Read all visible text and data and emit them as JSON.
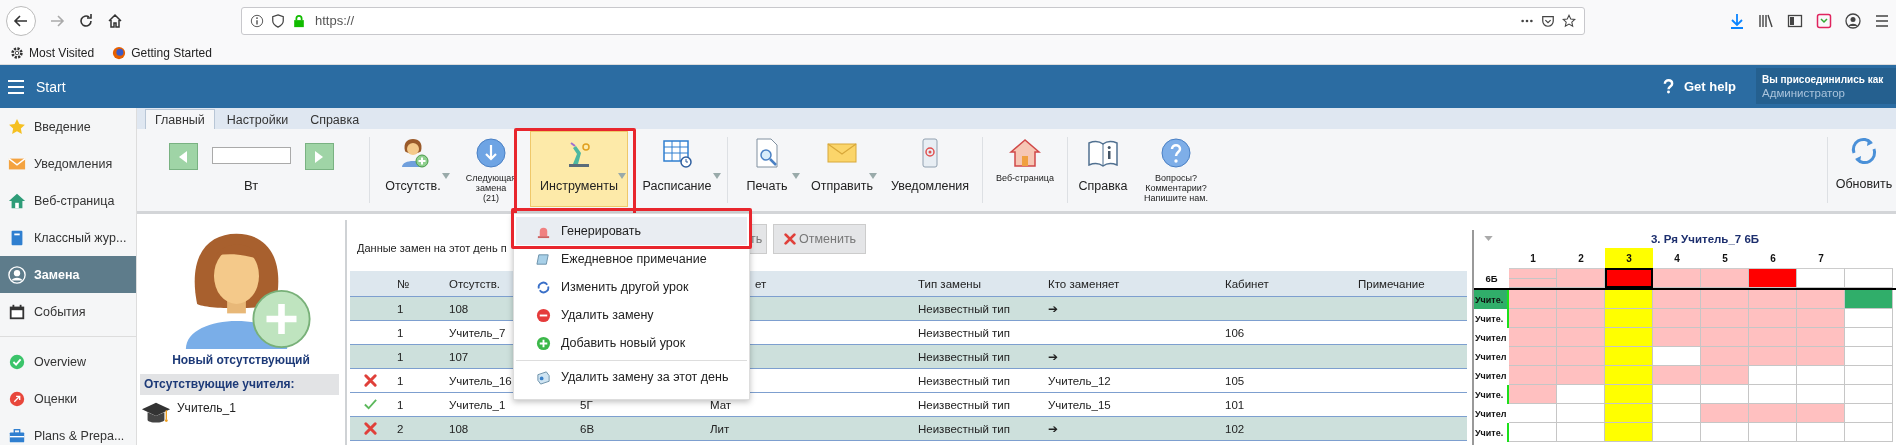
{
  "browser": {
    "url": "https://",
    "bookmarks": [
      {
        "label": "Most Visited"
      },
      {
        "label": "Getting Started"
      }
    ]
  },
  "header": {
    "title": "Start",
    "help": "Get help",
    "account": {
      "caption": "Вы присоединились как",
      "role": "Администратор"
    }
  },
  "sidebar": {
    "sections": [
      {
        "items": [
          {
            "label": "Введение",
            "selected": false
          },
          {
            "label": "Уведомления",
            "selected": false
          },
          {
            "label": "Веб-страница",
            "selected": false
          },
          {
            "label": "Классный жур...",
            "selected": false
          },
          {
            "label": "Замена",
            "selected": true
          },
          {
            "label": "События",
            "selected": false
          }
        ]
      },
      {
        "items": [
          {
            "label": "Overview",
            "selected": false
          },
          {
            "label": "Оценки",
            "selected": false
          },
          {
            "label": "Plans & Prepa...",
            "selected": false
          }
        ]
      }
    ]
  },
  "ribbon": {
    "tabs": [
      {
        "label": "Главный",
        "selected": true
      },
      {
        "label": "Настройки",
        "selected": false
      },
      {
        "label": "Справка",
        "selected": false
      }
    ],
    "date_nav": {
      "day": "Вт"
    },
    "groups": [
      {
        "buttons": [
          {
            "lines": [
              "Отсутств."
            ],
            "kind": "large",
            "dropdown": true,
            "highlighted": false,
            "framed": false
          },
          {
            "lines": [
              "Следующая",
              "замена",
              "(21)"
            ],
            "kind": "small",
            "dropdown": false,
            "highlighted": false,
            "framed": false
          },
          {
            "lines": [
              "Инструменты"
            ],
            "kind": "large",
            "dropdown": true,
            "highlighted": true,
            "framed": true
          },
          {
            "lines": [
              "Расписание"
            ],
            "kind": "large",
            "dropdown": true,
            "highlighted": false,
            "framed": false
          }
        ]
      },
      {
        "buttons": [
          {
            "lines": [
              "Печать"
            ],
            "kind": "large",
            "dropdown": true,
            "highlighted": false,
            "framed": false
          },
          {
            "lines": [
              "Отправить"
            ],
            "kind": "large",
            "dropdown": true,
            "highlighted": false,
            "framed": false
          },
          {
            "lines": [
              "Уведомления"
            ],
            "kind": "large",
            "dropdown": false,
            "highlighted": false,
            "framed": false
          }
        ]
      },
      {
        "buttons": [
          {
            "lines": [
              "Веб-страница"
            ],
            "kind": "small",
            "dropdown": false,
            "highlighted": false,
            "framed": false
          }
        ]
      },
      {
        "buttons": [
          {
            "lines": [
              "Справка"
            ],
            "kind": "large",
            "dropdown": false,
            "highlighted": false,
            "framed": false
          },
          {
            "lines": [
              "Вопросы?",
              "Комментарии?",
              "Напишите нам."
            ],
            "kind": "small",
            "dropdown": false,
            "highlighted": false,
            "framed": false
          }
        ]
      }
    ],
    "end_buttons": [
      {
        "lines": [
          "Обновить"
        ],
        "kind": "large",
        "dropdown": false,
        "highlighted": false,
        "framed": false
      }
    ]
  },
  "absent_panel": {
    "add_label": "Новый отсутствующий",
    "list_title": "Отсутствующие учителя:",
    "teachers": [
      {
        "name": "Учитель_1"
      }
    ]
  },
  "substitutions": {
    "title": "Данные замен на этот день п",
    "actions": [
      {
        "label": "ть",
        "kind": "plain"
      },
      {
        "label": "Отменить",
        "kind": "cancel"
      }
    ],
    "columns": {
      "number": "№",
      "absent": "Отсутств.",
      "column_5": "ет",
      "type": "Тип замены",
      "substitute": "Кто заменяет",
      "room": "Кабинет",
      "note": "Примечание"
    },
    "rows": [
      {
        "shaded": true,
        "rejected": false,
        "approved": false,
        "number": "1",
        "absent": "108",
        "type": "Неизвестный тип",
        "substitute": "➔"
      },
      {
        "shaded": false,
        "rejected": false,
        "approved": false,
        "number": "1",
        "absent": "Учитель_7",
        "type": "Неизвестный тип",
        "room": "106"
      },
      {
        "shaded": true,
        "rejected": false,
        "approved": false,
        "number": "1",
        "absent": "107",
        "type": "Неизвестный тип",
        "substitute": "➔"
      },
      {
        "shaded": false,
        "rejected": true,
        "approved": false,
        "number": "1",
        "absent": "Учитель_16",
        "type": "Неизвестный тип",
        "substitute": "Учитель_12",
        "room": "105"
      },
      {
        "shaded": false,
        "rejected": false,
        "approved": true,
        "number": "1",
        "absent": "Учитель_1",
        "class": "5Г",
        "subject": "Мат",
        "type": "Неизвестный тип",
        "substitute": "Учитель_15",
        "room": "101"
      },
      {
        "shaded": true,
        "rejected": true,
        "approved": false,
        "number": "2",
        "absent": "108",
        "class": "6В",
        "subject": "Лит",
        "type": "Неизвестный тип",
        "substitute": "➔",
        "room": "102"
      }
    ]
  },
  "tools_menu": {
    "items": [
      {
        "label": "Генерировать",
        "selected": true,
        "framed": true,
        "separated": false
      },
      {
        "label": "Ежедневное примечание",
        "selected": false,
        "framed": false,
        "separated": false
      },
      {
        "label": "Изменить другой урок",
        "selected": false,
        "framed": false,
        "separated": false
      },
      {
        "label": "Удалить замену",
        "selected": false,
        "framed": false,
        "separated": false
      },
      {
        "label": "Добавить новый урок",
        "selected": false,
        "framed": false,
        "separated": false
      },
      {
        "label": "Удалить замену за этот день",
        "selected": false,
        "framed": false,
        "separated": true
      }
    ]
  },
  "timetable": {
    "title": "3. Ря Учитель_7 6Б",
    "columns": [
      {
        "label": "1",
        "selected": false
      },
      {
        "label": "2",
        "selected": false
      },
      {
        "label": "3",
        "selected": true
      },
      {
        "label": "4",
        "selected": false
      },
      {
        "label": "5",
        "selected": false
      },
      {
        "label": "6",
        "selected": false
      },
      {
        "label": "7",
        "selected": false
      }
    ],
    "class_row": {
      "label": "6Б",
      "split_first": true,
      "cells": [
        {
          "color": "#ffc0c0"
        },
        {
          "color": "#ffc0c0"
        },
        {
          "color": "#ff0000"
        },
        {
          "color": "#ffc0c0"
        },
        {
          "color": "#ffc0c0"
        },
        {
          "color": "#ff0000"
        },
        {
          "color": "#ffffff"
        },
        {
          "color": "#ffffff"
        }
      ]
    },
    "rows": [
      {
        "label": "Учите.",
        "highlighted": true,
        "marked": true,
        "cells": [
          {
            "color": "#ffc0c0"
          },
          {
            "color": "#ffc0c0"
          },
          {
            "color": "#ffff00"
          },
          {
            "color": "#ffc0c0"
          },
          {
            "color": "#ffc0c0"
          },
          {
            "color": "#ffc0c0"
          },
          {
            "color": "#ffc0c0"
          },
          {
            "color": "#30ae6a"
          }
        ]
      },
      {
        "label": "Учите.",
        "highlighted": false,
        "marked": true,
        "cells": [
          {
            "color": "#ffc0c0"
          },
          {
            "color": "#ffc0c0"
          },
          {
            "color": "#ffff00"
          },
          {
            "color": "#ffc0c0"
          },
          {
            "color": "#ffc0c0"
          },
          {
            "color": "#ffc0c0"
          },
          {
            "color": "#ffc0c0"
          },
          {
            "color": "#ffffff"
          }
        ]
      },
      {
        "label": "Учител",
        "highlighted": false,
        "marked": false,
        "cells": [
          {
            "color": "#ffc0c0"
          },
          {
            "color": "#ffc0c0"
          },
          {
            "color": "#ffff00"
          },
          {
            "color": "#ffc0c0"
          },
          {
            "color": "#ffc0c0"
          },
          {
            "color": "#ffc0c0"
          },
          {
            "color": "#ffc0c0"
          },
          {
            "color": "#ffffff"
          }
        ]
      },
      {
        "label": "Учител",
        "highlighted": false,
        "marked": false,
        "cells": [
          {
            "color": "#ffc0c0"
          },
          {
            "color": "#ffc0c0"
          },
          {
            "color": "#ffff00"
          },
          {
            "color": "#ffffff"
          },
          {
            "color": "#ffc0c0"
          },
          {
            "color": "#ffc0c0"
          },
          {
            "color": "#ffc0c0"
          },
          {
            "color": "#ffffff"
          }
        ]
      },
      {
        "label": "Учител",
        "highlighted": false,
        "marked": false,
        "cells": [
          {
            "color": "#ffc0c0"
          },
          {
            "color": "#ffc0c0"
          },
          {
            "color": "#ffff00"
          },
          {
            "color": "#ffc0c0"
          },
          {
            "color": "#ffc0c0"
          },
          {
            "color": "#ffffff"
          },
          {
            "color": "#ffffff"
          },
          {
            "color": "#ffffff"
          }
        ]
      },
      {
        "label": "Учите.",
        "highlighted": false,
        "marked": true,
        "cells": [
          {
            "color": "#ffc0c0"
          },
          {
            "color": "#ffffff"
          },
          {
            "color": "#ffff00"
          },
          {
            "color": "#ffffff"
          },
          {
            "color": "#ffffff"
          },
          {
            "color": "#ffffff"
          },
          {
            "color": "#ffffff"
          },
          {
            "color": "#ffffff"
          }
        ]
      },
      {
        "label": "Учител",
        "highlighted": false,
        "marked": false,
        "cells": [
          {
            "color": "#ffffff"
          },
          {
            "color": "#ffffff"
          },
          {
            "color": "#ffff00"
          },
          {
            "color": "#ffffff"
          },
          {
            "color": "#ffc0c0"
          },
          {
            "color": "#ffc0c0"
          },
          {
            "color": "#ffc0c0"
          },
          {
            "color": "#ffffff"
          }
        ]
      },
      {
        "label": "Учите.",
        "highlighted": false,
        "marked": true,
        "cells": [
          {
            "color": "#ffffff"
          },
          {
            "color": "#ffffff"
          },
          {
            "color": "#ffff00"
          },
          {
            "color": "#ffffff"
          },
          {
            "color": "#ffffff"
          },
          {
            "color": "#ffffff"
          },
          {
            "color": "#ffffff"
          },
          {
            "color": "#ffffff"
          }
        ]
      }
    ]
  }
}
